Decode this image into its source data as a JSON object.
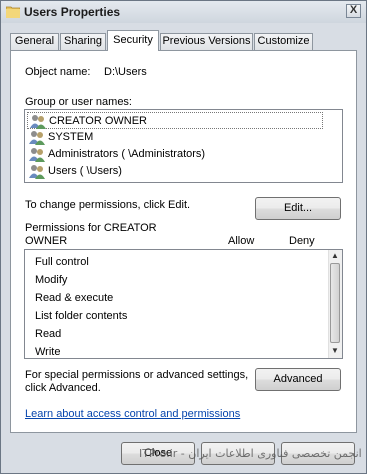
{
  "window": {
    "title": "Users Properties",
    "close_label": "X"
  },
  "tabs": [
    {
      "label": "General",
      "active": false
    },
    {
      "label": "Sharing",
      "active": false
    },
    {
      "label": "Security",
      "active": true
    },
    {
      "label": "Previous Versions",
      "active": false
    },
    {
      "label": "Customize",
      "active": false
    }
  ],
  "security": {
    "object_name_label": "Object name:",
    "object_name_value": "D:\\Users",
    "group_label": "Group or user names:",
    "users": [
      {
        "name": "CREATOR OWNER",
        "icon": "user-group-icon"
      },
      {
        "name": "SYSTEM",
        "icon": "user-group-icon"
      },
      {
        "name": "Administrators (   \\Administrators)",
        "icon": "user-group-icon"
      },
      {
        "name": "Users (   \\Users)",
        "icon": "user-group-icon"
      }
    ],
    "change_text": "To change permissions, click Edit.",
    "edit_label": "Edit...",
    "permissions_label_line1": "Permissions for CREATOR",
    "permissions_label_line2": "OWNER",
    "allow_header": "Allow",
    "deny_header": "Deny",
    "permissions": [
      "Full control",
      "Modify",
      "Read & execute",
      "List folder contents",
      "Read",
      "Write"
    ],
    "advanced_text_line1": "For special permissions or advanced settings,",
    "advanced_text_line2": "click Advanced.",
    "advanced_label": "Advanced",
    "learn_link": "Learn about access control and permissions"
  },
  "footer": {
    "close_label": "Close",
    "watermark": "ITPro.ir - انجمن تخصصی فناوری اطلاعات ایران"
  },
  "colors": {
    "link": "#0645ad",
    "title_bar": "#cfd6de",
    "panel": "#ffffff"
  }
}
